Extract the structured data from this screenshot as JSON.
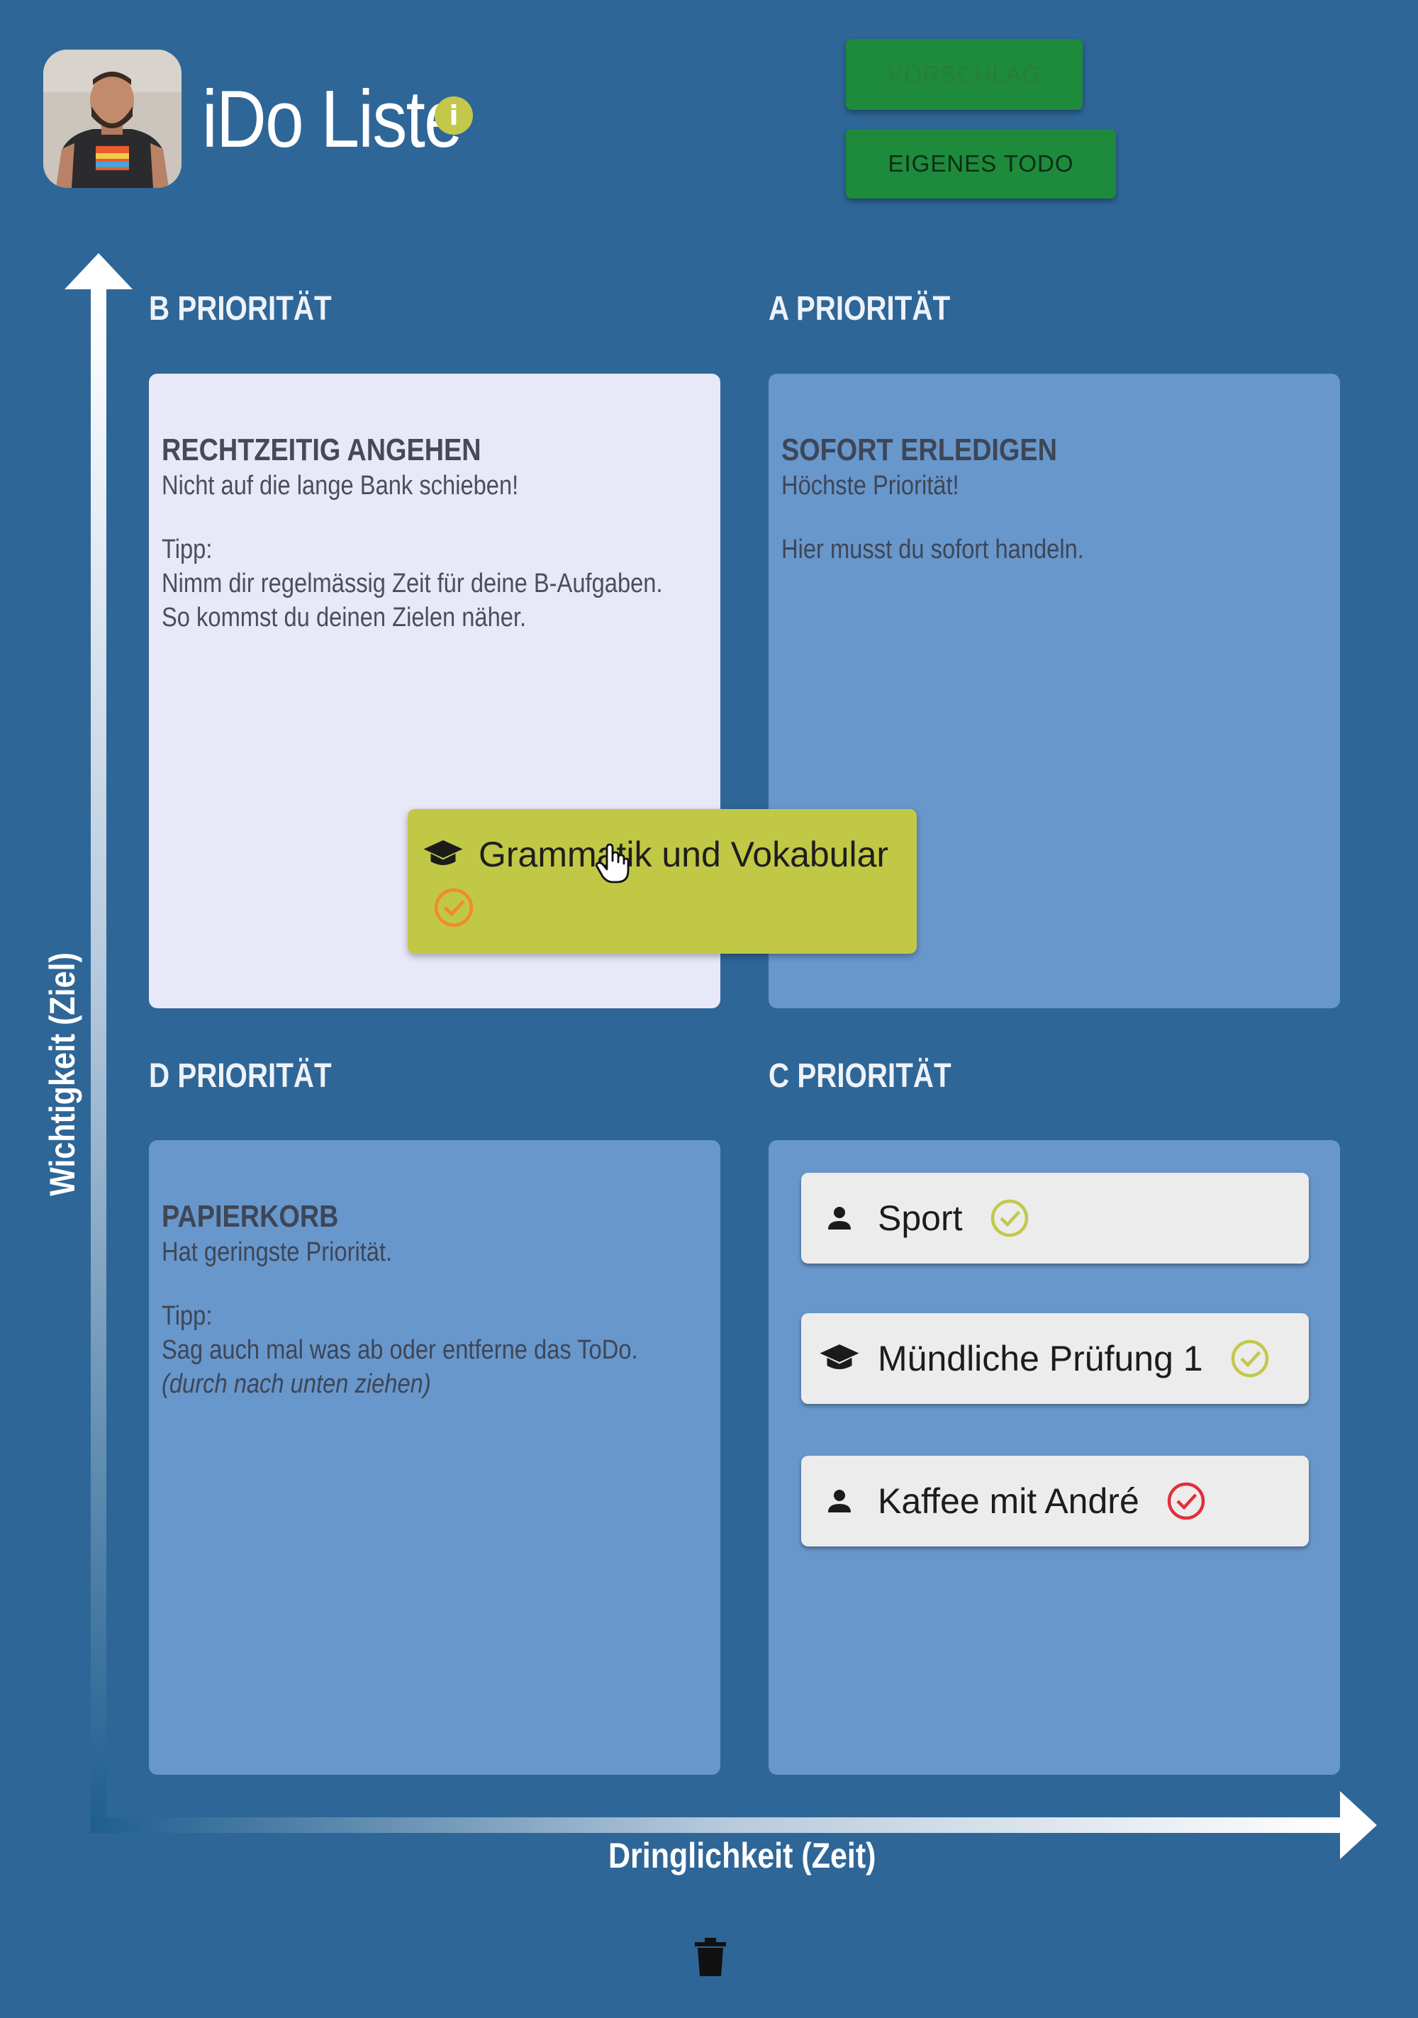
{
  "header": {
    "app_title": "iDo Liste",
    "info_icon_glyph": "i",
    "suggest_button": "VORSCHLAG",
    "own_todo_button": "EIGENES TODO"
  },
  "axes": {
    "x_label": "Dringlichkeit (Zeit)",
    "y_label": "Wichtigkeit (Ziel)"
  },
  "quadrants": {
    "b": {
      "label": "B PRIORITÄT",
      "heading": "RECHTZEITIG ANGEHEN",
      "subheading": "Nicht auf die lange Bank schieben!",
      "tip_label": "Tipp:",
      "tip_line1": "Nimm dir regelmässig Zeit für deine B-Aufgaben.",
      "tip_line2": "So kommst du deinen Zielen näher."
    },
    "a": {
      "label": "A PRIORITÄT",
      "heading": "SOFORT ERLEDIGEN",
      "subheading": "Höchste Priorität!",
      "body": "Hier musst du sofort handeln."
    },
    "d": {
      "label": "D PRIORITÄT",
      "heading": "PAPIERKORB",
      "subheading": "Hat geringste Priorität.",
      "tip_label": "Tipp:",
      "tip_line1": "Sag auch mal was ab oder entferne das ToDo.",
      "tip_line2": "(durch nach unten ziehen)"
    },
    "c": {
      "label": "C PRIORITÄT",
      "todos": [
        {
          "text": "Sport",
          "icon": "person-icon",
          "status": "done",
          "status_color": "#c3c84a"
        },
        {
          "text": "Mündliche Prüfung 1",
          "icon": "graduation-cap-icon",
          "status": "done",
          "status_color": "#c3c84a"
        },
        {
          "text": "Kaffee mit André",
          "icon": "person-icon",
          "status": "overdue",
          "status_color": "#e0303a"
        }
      ]
    }
  },
  "dragged_todo": {
    "text": "Grammatik und Vokabular",
    "icon": "graduation-cap-icon",
    "status": "pending",
    "status_color": "#f08a30"
  },
  "footer": {
    "trash_icon": "trash-icon"
  },
  "colors": {
    "background": "#2e6698",
    "quadrant_active": "#e8e8f8",
    "quadrant": "#6897cc",
    "button": "#1d8a3c",
    "dragged_card": "#c1c845"
  }
}
